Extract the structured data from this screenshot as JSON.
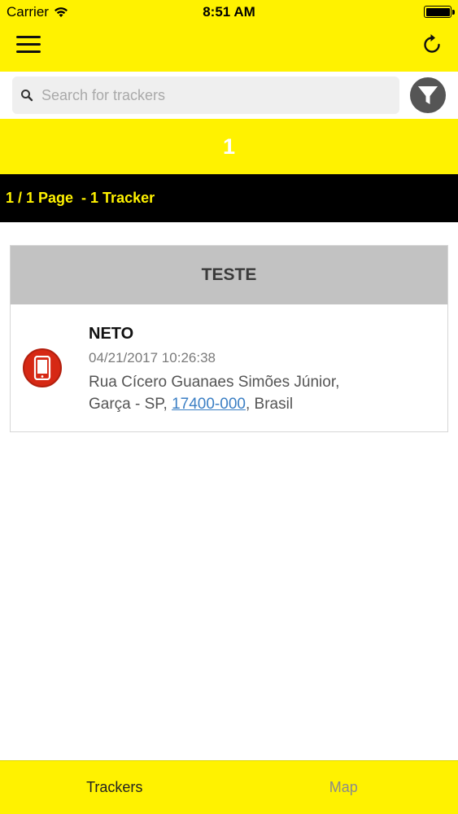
{
  "status_bar": {
    "carrier": "Carrier",
    "time": "8:51 AM"
  },
  "search": {
    "placeholder": "Search for trackers"
  },
  "summary": {
    "count": "1",
    "page_info": "1 / 1 Page  - 1 Tracker"
  },
  "group": {
    "name": "TESTE",
    "trackers": [
      {
        "name": "NETO",
        "timestamp": "04/21/2017 10:26:38",
        "address_line1": "Rua Cícero Guanaes Simões Júnior,",
        "address_prefix": "Garça - SP, ",
        "postal_code": "17400-000",
        "address_suffix": ", Brasil"
      }
    ]
  },
  "tabs": {
    "trackers": "Trackers",
    "map": "Map"
  },
  "colors": {
    "brand_yellow": "#fff200",
    "page_band": "#000000",
    "device_icon": "#d62814",
    "link": "#3b7fc4"
  }
}
